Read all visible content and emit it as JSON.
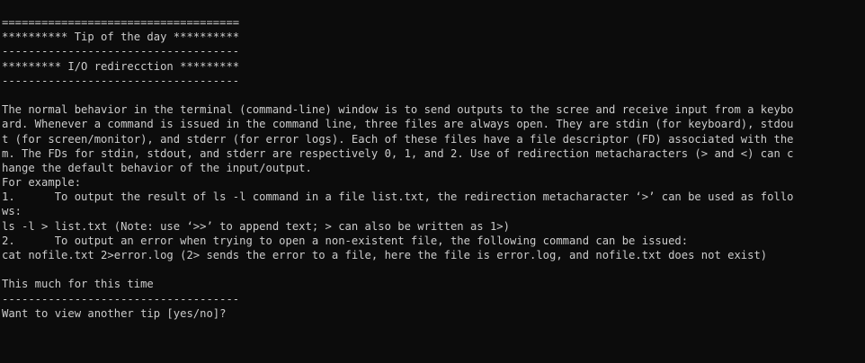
{
  "terminal": {
    "colors": {
      "background": "#0c0c0c",
      "foreground": "#cccccc"
    },
    "header": {
      "rule_top": "====================================",
      "title": "********** Tip of the day **********",
      "rule_mid": "------------------------------------",
      "subtitle": "********* I/O redirecction *********",
      "rule_bottom": "------------------------------------"
    },
    "body_lines": [
      "The normal behavior in the terminal (command-line) window is to send outputs to the scree and receive input from a keybo",
      "ard. Whenever a command is issued in the command line, three files are always open. They are stdin (for keyboard), stdou",
      "t (for screen/monitor), and stderr (for error logs). Each of these files have a file descriptor (FD) associated with the",
      "m. The FDs for stdin, stdout, and stderr are respectively 0, 1, and 2. Use of redirection metacharacters (> and <) can c",
      "hange the default behavior of the input/output.",
      "For example:",
      "1.      To output the result of ls -l command in a file list.txt, the redirection metacharacter ‘>’ can be used as follo",
      "ws:",
      "ls -l > list.txt (Note: use ‘>>’ to append text; > can also be written as 1>)",
      "2.      To output an error when trying to open a non-existent file, the following command can be issued:",
      "cat nofile.txt 2>error.log (2> sends the error to a file, here the file is error.log, and nofile.txt does not exist)"
    ],
    "footer": {
      "closing": "This much for this time",
      "rule": "------------------------------------",
      "prompt": "Want to view another tip [yes/no]?"
    }
  }
}
